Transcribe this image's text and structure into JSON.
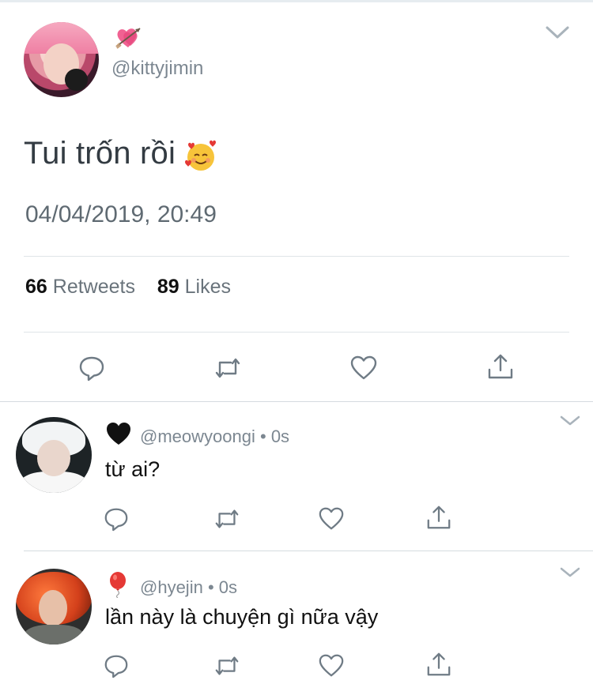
{
  "main_tweet": {
    "handle": "@kittyjimin",
    "text": "Tui trốn rồi",
    "timestamp": "04/04/2019, 20:49",
    "retweets_count": "66",
    "retweets_label": "Retweets",
    "likes_count": "89",
    "likes_label": "Likes",
    "name_emoji": "heart-with-arrow-icon",
    "text_emoji": "smiling-face-with-hearts-icon"
  },
  "replies": [
    {
      "handle": "@meowyoongi",
      "separator": "•",
      "time": "0s",
      "text": "từ ai?",
      "name_emoji": "black-heart-icon"
    },
    {
      "handle": "@hyejin",
      "separator": "•",
      "time": "0s",
      "text": "lần này là chuyện gì nữa vậy",
      "name_emoji": "balloon-icon"
    }
  ],
  "colors": {
    "icon_gray": "#6f7b85",
    "text_gray": "#7c8791",
    "divider": "#dfe4e8"
  }
}
